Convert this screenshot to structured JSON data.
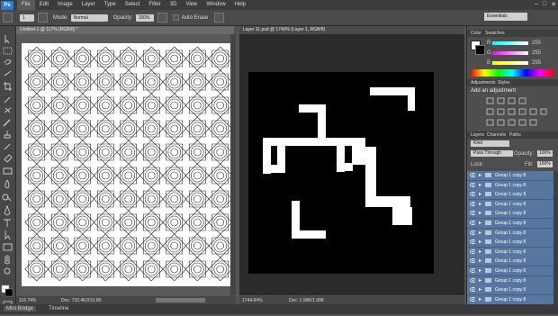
{
  "app": {
    "logo": "Ps"
  },
  "menu": [
    "File",
    "Edit",
    "Image",
    "Layer",
    "Type",
    "Select",
    "Filter",
    "3D",
    "View",
    "Window",
    "Help"
  ],
  "options": {
    "mode_label": "Mode:",
    "mode_value": "Normal",
    "opacity_label": "Opacity:",
    "opacity_value": "100%",
    "auto_erase": "Auto Erase",
    "brush_size": "1",
    "workspace": "Essentials"
  },
  "doc1": {
    "tab": "Untitled-1 @ 117% (RGB/8) *",
    "zoom": "116.74%",
    "doc_size": "Doc: 732.4K/215.9K"
  },
  "doc2": {
    "tab": "Layer 11.psd @ 1740% (Layer 1, RGB/8)",
    "zoom": "1744.94%",
    "doc_size": "Doc: 1.99K/1.99K"
  },
  "color_panel": {
    "tabs": [
      "Color",
      "Swatches"
    ],
    "r": "R",
    "g": "G",
    "b": "B",
    "r_val": "255",
    "g_val": "255",
    "b_val": "255"
  },
  "adjustments_panel": {
    "tabs": [
      "Adjustments",
      "Styles"
    ],
    "title": "Add an adjustment"
  },
  "layers_panel": {
    "tabs": [
      "Layers",
      "Channels",
      "Paths"
    ],
    "kind": "Kind",
    "blend": "Pass Through",
    "opacity_label": "Opacity:",
    "opacity": "100%",
    "lock_label": "Lock:",
    "fill_label": "Fill:",
    "fill": "100%",
    "layers": [
      "Group 1 copy 8",
      "Group 1 copy 8",
      "Group 1 copy 8",
      "Group 1 copy 8",
      "Group 1 copy 8",
      "Group 1 copy 8",
      "Group 1 copy 8",
      "Group 1 copy 8",
      "Group 1 copy 8",
      "Group 1 copy 8",
      "Group 1 copy 8",
      "Group 1 copy 8",
      "Group 1 copy 8",
      "Group 1 copy 8"
    ]
  },
  "bottom": {
    "mini_bridge": "Mini Bridge",
    "timeline": "Timeline"
  },
  "colors": {
    "accent": "#2d7ad6",
    "layer_selected": "#5777a0"
  }
}
